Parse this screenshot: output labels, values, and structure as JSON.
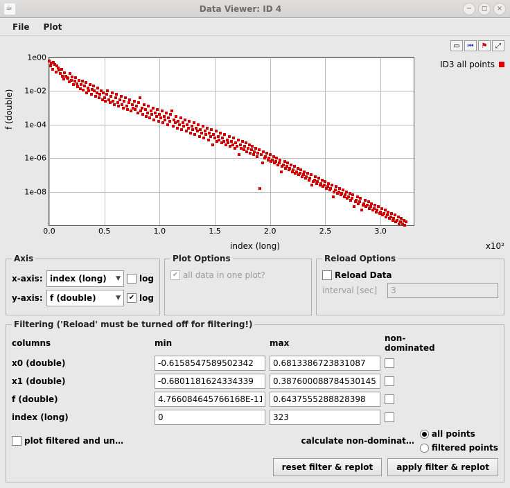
{
  "window": {
    "title": "Data Viewer: ID 4"
  },
  "menubar": {
    "file": "File",
    "plot": "Plot"
  },
  "toolbar_icons": [
    "save-icon",
    "rewind-icon",
    "pin-icon",
    "expand-icon"
  ],
  "chart_data": {
    "type": "scatter",
    "title": "",
    "xlabel": "index (long)",
    "ylabel": "f (double)",
    "x_multiplier_label": "x10²",
    "xlim": [
      0.0,
      3.3
    ],
    "ylim_log10": [
      -10,
      0
    ],
    "xticks": [
      "0.0",
      "0.5",
      "1.0",
      "1.5",
      "2.0",
      "2.5",
      "3.0"
    ],
    "yticks": [
      "1e00",
      "1e-02",
      "1e-04",
      "1e-06",
      "1e-08"
    ],
    "yscale": "log",
    "legend": {
      "position": "right",
      "entries": [
        "ID3 all points"
      ]
    },
    "colors": {
      "series0": "#d40000"
    },
    "series": [
      {
        "name": "ID3 all points",
        "x": [
          0.0,
          0.01,
          0.02,
          0.03,
          0.04,
          0.05,
          0.06,
          0.07,
          0.08,
          0.09,
          0.1,
          0.11,
          0.12,
          0.13,
          0.14,
          0.15,
          0.16,
          0.17,
          0.18,
          0.19,
          0.2,
          0.21,
          0.22,
          0.23,
          0.24,
          0.25,
          0.26,
          0.27,
          0.28,
          0.29,
          0.3,
          0.31,
          0.32,
          0.33,
          0.34,
          0.35,
          0.36,
          0.37,
          0.38,
          0.39,
          0.4,
          0.41,
          0.42,
          0.43,
          0.44,
          0.45,
          0.46,
          0.47,
          0.48,
          0.49,
          0.5,
          0.51,
          0.52,
          0.53,
          0.54,
          0.55,
          0.56,
          0.57,
          0.58,
          0.59,
          0.6,
          0.61,
          0.62,
          0.63,
          0.64,
          0.65,
          0.66,
          0.67,
          0.68,
          0.69,
          0.7,
          0.71,
          0.72,
          0.73,
          0.74,
          0.75,
          0.76,
          0.77,
          0.78,
          0.79,
          0.8,
          0.81,
          0.82,
          0.83,
          0.84,
          0.85,
          0.86,
          0.87,
          0.88,
          0.89,
          0.9,
          0.91,
          0.92,
          0.93,
          0.94,
          0.95,
          0.96,
          0.97,
          0.98,
          0.99,
          1.0,
          1.01,
          1.02,
          1.03,
          1.04,
          1.05,
          1.06,
          1.07,
          1.08,
          1.09,
          1.1,
          1.11,
          1.12,
          1.13,
          1.14,
          1.15,
          1.16,
          1.17,
          1.18,
          1.19,
          1.2,
          1.21,
          1.22,
          1.23,
          1.24,
          1.25,
          1.26,
          1.27,
          1.28,
          1.29,
          1.3,
          1.31,
          1.32,
          1.33,
          1.34,
          1.35,
          1.36,
          1.37,
          1.38,
          1.39,
          1.4,
          1.41,
          1.42,
          1.43,
          1.44,
          1.45,
          1.46,
          1.47,
          1.48,
          1.49,
          1.5,
          1.51,
          1.52,
          1.53,
          1.54,
          1.55,
          1.56,
          1.57,
          1.58,
          1.59,
          1.6,
          1.61,
          1.62,
          1.63,
          1.64,
          1.65,
          1.66,
          1.67,
          1.68,
          1.69,
          1.7,
          1.71,
          1.72,
          1.73,
          1.74,
          1.75,
          1.76,
          1.77,
          1.78,
          1.79,
          1.8,
          1.81,
          1.82,
          1.83,
          1.84,
          1.85,
          1.86,
          1.87,
          1.88,
          1.89,
          1.9,
          1.91,
          1.92,
          1.93,
          1.94,
          1.95,
          1.96,
          1.97,
          1.98,
          1.99,
          2.0,
          2.01,
          2.02,
          2.03,
          2.04,
          2.05,
          2.06,
          2.07,
          2.08,
          2.09,
          2.1,
          2.11,
          2.12,
          2.13,
          2.14,
          2.15,
          2.16,
          2.17,
          2.18,
          2.19,
          2.2,
          2.21,
          2.22,
          2.23,
          2.24,
          2.25,
          2.26,
          2.27,
          2.28,
          2.29,
          2.3,
          2.31,
          2.32,
          2.33,
          2.34,
          2.35,
          2.36,
          2.37,
          2.38,
          2.39,
          2.4,
          2.41,
          2.42,
          2.43,
          2.44,
          2.45,
          2.46,
          2.47,
          2.48,
          2.49,
          2.5,
          2.51,
          2.52,
          2.53,
          2.54,
          2.55,
          2.56,
          2.57,
          2.58,
          2.59,
          2.6,
          2.61,
          2.62,
          2.63,
          2.64,
          2.65,
          2.66,
          2.67,
          2.68,
          2.69,
          2.7,
          2.71,
          2.72,
          2.73,
          2.74,
          2.75,
          2.76,
          2.77,
          2.78,
          2.79,
          2.8,
          2.81,
          2.82,
          2.83,
          2.84,
          2.85,
          2.86,
          2.87,
          2.88,
          2.89,
          2.9,
          2.91,
          2.92,
          2.93,
          2.94,
          2.95,
          2.96,
          2.97,
          2.98,
          2.99,
          3.0,
          3.01,
          3.02,
          3.03,
          3.04,
          3.05,
          3.06,
          3.07,
          3.08,
          3.09,
          3.1,
          3.11,
          3.12,
          3.13,
          3.14,
          3.15,
          3.16,
          3.17,
          3.18,
          3.19,
          3.2,
          3.21,
          3.22,
          3.23
        ],
        "log10_y": [
          -0.19,
          -0.5,
          -0.35,
          -0.7,
          -0.28,
          -0.4,
          -0.87,
          -0.5,
          -0.63,
          -0.75,
          -0.95,
          -0.7,
          -1.1,
          -1.3,
          -0.9,
          -1.1,
          -1.2,
          -1.25,
          -1.45,
          -0.95,
          -1.35,
          -1.15,
          -1.6,
          -1.4,
          -1.2,
          -1.55,
          -1.75,
          -1.35,
          -1.85,
          -1.6,
          -1.4,
          -1.95,
          -1.7,
          -1.5,
          -2.1,
          -1.8,
          -2.0,
          -1.6,
          -2.2,
          -1.9,
          -1.7,
          -2.0,
          -2.3,
          -2.1,
          -1.8,
          -2.4,
          -2.2,
          -2.0,
          -2.5,
          -2.1,
          -2.4,
          -2.6,
          -2.2,
          -2.0,
          -2.5,
          -2.7,
          -2.3,
          -2.1,
          -2.6,
          -2.8,
          -2.4,
          -2.2,
          -2.7,
          -2.9,
          -2.5,
          -2.3,
          -2.8,
          -3.0,
          -2.6,
          -2.4,
          -2.9,
          -3.1,
          -2.7,
          -2.5,
          -3.2,
          -2.8,
          -3.0,
          -2.6,
          -3.1,
          -2.9,
          -3.3,
          -2.7,
          -2.4,
          -3.2,
          -3.0,
          -3.4,
          -2.8,
          -3.1,
          -3.5,
          -3.3,
          -2.9,
          -3.6,
          -3.2,
          -3.4,
          -3.0,
          -3.7,
          -3.3,
          -3.5,
          -3.1,
          -3.8,
          -3.4,
          -3.6,
          -3.2,
          -3.9,
          -3.5,
          -3.7,
          -3.3,
          -4.0,
          -3.6,
          -3.8,
          -3.4,
          -3.2,
          -4.1,
          -3.7,
          -3.9,
          -3.5,
          -4.2,
          -3.8,
          -4.0,
          -3.6,
          -4.3,
          -3.9,
          -4.1,
          -3.7,
          -4.4,
          -4.0,
          -4.2,
          -3.8,
          -4.5,
          -4.1,
          -4.3,
          -3.9,
          -4.6,
          -4.2,
          -4.4,
          -4.0,
          -4.7,
          -4.3,
          -4.5,
          -4.1,
          -4.8,
          -4.4,
          -4.6,
          -4.2,
          -4.9,
          -4.5,
          -4.7,
          -4.3,
          -5.2,
          -4.6,
          -4.8,
          -4.4,
          -5.0,
          -4.7,
          -4.9,
          -4.5,
          -5.1,
          -4.8,
          -5.0,
          -4.6,
          -5.2,
          -4.9,
          -5.1,
          -4.7,
          -5.3,
          -5.0,
          -5.2,
          -4.8,
          -5.4,
          -5.1,
          -5.3,
          -4.9,
          -5.8,
          -5.2,
          -5.4,
          -5.0,
          -5.5,
          -5.3,
          -5.1,
          -5.6,
          -5.4,
          -5.2,
          -5.7,
          -5.5,
          -5.3,
          -5.8,
          -5.6,
          -5.4,
          -5.9,
          -5.7,
          -5.5,
          -7.8,
          -5.8,
          -6.3,
          -5.6,
          -6.0,
          -5.9,
          -5.7,
          -6.1,
          -6.0,
          -5.8,
          -6.2,
          -6.1,
          -5.9,
          -6.3,
          -6.2,
          -6.0,
          -6.4,
          -6.3,
          -6.1,
          -6.8,
          -6.5,
          -6.4,
          -6.2,
          -6.6,
          -6.5,
          -6.3,
          -6.7,
          -6.6,
          -6.4,
          -6.8,
          -6.7,
          -6.5,
          -6.9,
          -6.8,
          -6.6,
          -7.0,
          -6.9,
          -6.7,
          -7.1,
          -7.0,
          -6.8,
          -7.2,
          -7.1,
          -6.9,
          -7.3,
          -7.2,
          -7.0,
          -7.6,
          -7.4,
          -7.3,
          -7.1,
          -7.5,
          -7.4,
          -7.2,
          -7.6,
          -7.5,
          -7.3,
          -7.7,
          -7.6,
          -7.4,
          -7.8,
          -7.7,
          -7.5,
          -7.9,
          -7.8,
          -7.6,
          -8.3,
          -8.0,
          -7.9,
          -7.7,
          -8.1,
          -8.0,
          -7.8,
          -8.2,
          -8.1,
          -7.9,
          -8.3,
          -8.2,
          -8.0,
          -8.4,
          -8.3,
          -8.1,
          -8.5,
          -8.4,
          -8.2,
          -8.9,
          -8.6,
          -8.5,
          -8.3,
          -8.7,
          -8.6,
          -8.4,
          -9.1,
          -8.8,
          -8.7,
          -8.5,
          -8.9,
          -8.8,
          -8.6,
          -9.0,
          -8.9,
          -8.7,
          -9.1,
          -9.0,
          -8.8,
          -9.2,
          -9.1,
          -8.9,
          -9.3,
          -9.2,
          -9.0,
          -9.4,
          -9.3,
          -9.1,
          -9.5,
          -9.4,
          -9.2,
          -9.6,
          -9.5,
          -9.3,
          -9.7,
          -9.6,
          -9.4,
          -9.8,
          -9.7,
          -9.5,
          -9.9,
          -9.8,
          -9.6,
          -9.9,
          -9.7,
          -10.0,
          -9.8,
          -10.32
        ]
      }
    ]
  },
  "axis": {
    "x_label": "x-axis:",
    "y_label": "y-axis:",
    "x_select": "index (long)",
    "y_select": "f (double)",
    "log_label": "log",
    "x_log_checked": false,
    "y_log_checked": true
  },
  "fieldset_titles": {
    "axis": "Axis",
    "plot_options": "Plot Options",
    "reload_options": "Reload Options",
    "filtering": "Filtering ('Reload' must be turned off for filtering!)"
  },
  "plot_options": {
    "all_data_label": "all data in one plot?",
    "all_data_checked": true
  },
  "reload": {
    "reload_label": "Reload Data",
    "reload_checked": false,
    "interval_label": "interval [sec]",
    "interval_value": "3"
  },
  "filtering": {
    "headers": {
      "columns": "columns",
      "min": "min",
      "max": "max",
      "nondom": "non-dominated"
    },
    "rows": [
      {
        "col": "x0 (double)",
        "min": "-0.6158547589502342",
        "max": "0.6813386723831087",
        "nd": false
      },
      {
        "col": "x1 (double)",
        "min": "-0.6801181624334339",
        "max": "0.387600088784530145",
        "nd": false
      },
      {
        "col": "f (double)",
        "min": "4.766084645766168E-11",
        "max": "0.6437555288828398",
        "nd": false
      },
      {
        "col": "index (long)",
        "min": "0",
        "max": "323",
        "nd": false
      }
    ],
    "plot_filtered_label": "plot filtered and un…",
    "plot_filtered_checked": false,
    "calc_nondom_label": "calculate non-dominat…",
    "radio_all": "all points",
    "radio_filtered": "filtered points",
    "radio_selected": "all",
    "btn_reset": "reset filter & replot",
    "btn_apply": "apply filter & replot"
  }
}
